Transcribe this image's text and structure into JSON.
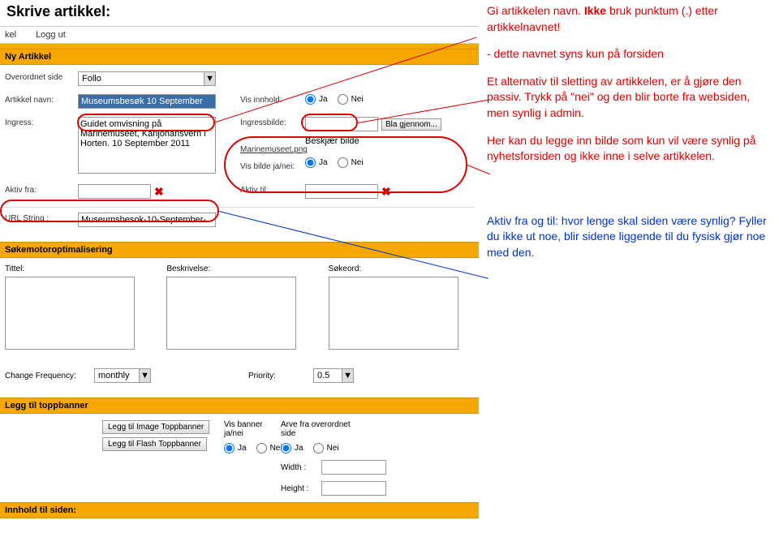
{
  "page": {
    "title": "Skrive artikkel:"
  },
  "nav": {
    "item1": "kel",
    "item2": "Logg ut"
  },
  "sections": {
    "nyArtikkel": "Ny Artikkel",
    "seo": "Søkemotoroptimalisering",
    "toppbanner": "Legg til toppbanner",
    "innhold": "Innhold til siden:"
  },
  "labels": {
    "overordnet": "Overordnet side",
    "artikkelNavn": "Artikkel navn:",
    "ingress": "Ingress:",
    "ingressbilde": "Ingressbilde:",
    "visInnhold": "Vis innhold:",
    "visBilde": "Vis bilde ja/nei:",
    "beskjaer": "Beskjær bilde",
    "aktivFra": "Aktiv fra:",
    "aktivTil": "Aktiv til:",
    "urlString": "URL String :",
    "tittel": "Tittel:",
    "beskrivelse": "Beskrivelse:",
    "sokeord": "Søkeord:",
    "changeFreq": "Change Frequency:",
    "priority": "Priority:",
    "leggImage": "Legg til Image Toppbanner",
    "leggFlash": "Legg til Flash Toppbanner",
    "visBanner": "Vis banner ja/nei",
    "arveFra": "Arve fra overordnet side",
    "width": "Width :",
    "height": "Height :",
    "ja": "Ja",
    "nei": "Nei",
    "blaGjennom": "Bla gjennom..."
  },
  "values": {
    "overordnet": "Follo",
    "artikkelNavn": "Museumsbesøk 10 September",
    "ingress": "Guidet omvisning på Marinemuseet, Karljohansvern i Horten. 10 September 2011",
    "ingressFil": "Marinemuseet.png",
    "urlString": "Museumsbesok-10-September-",
    "changeFreq": "monthly",
    "priority": "0.5"
  },
  "notes": {
    "n1a": "Gi artikkelen navn. ",
    "n1b": "Ikke",
    "n1c": " bruk punktum (.) etter artikkelnavnet!",
    "n2": "- dette navnet syns kun på forsiden",
    "n3": "Et alternativ til sletting av artikkelen, er å gjøre den passiv. Trykk på \"nei\" og den blir borte fra websiden, men synlig i admin.",
    "n4": "Her kan du legge inn bilde som kun vil være synlig på nyhetsforsiden og ikke inne i selve artikkelen.",
    "n5": "Aktiv fra og til: hvor lenge skal siden være synlig? Fyller du ikke ut noe, blir sidene liggende til du fysisk gjør noe med den."
  }
}
